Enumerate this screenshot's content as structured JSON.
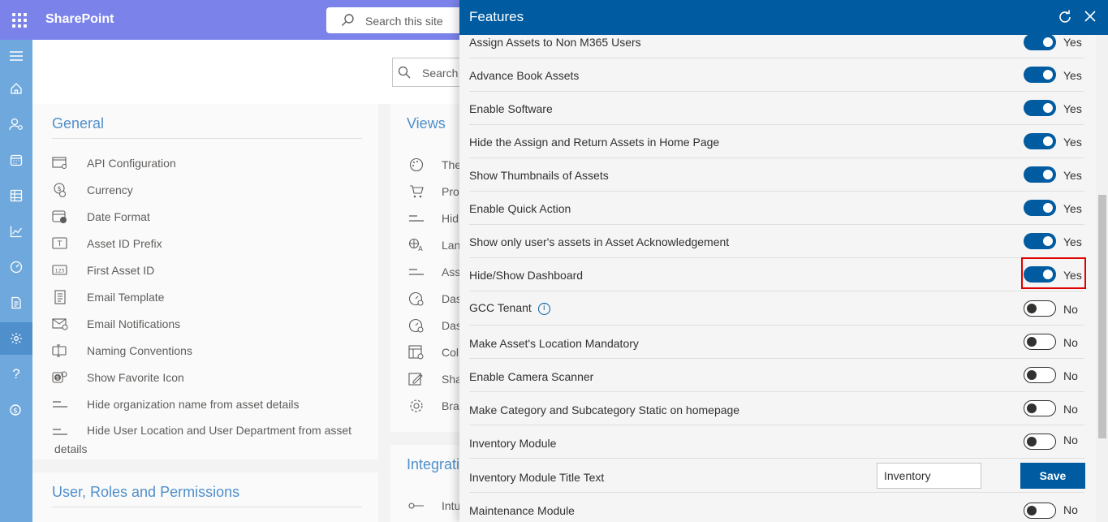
{
  "topbar": {
    "app_name": "SharePoint",
    "search_placeholder": "Search this site"
  },
  "main": {
    "search_placeholder": "Search"
  },
  "general": {
    "title": "General",
    "items": [
      {
        "label": "API Configuration",
        "icon": "api-config-icon"
      },
      {
        "label": "Currency",
        "icon": "currency-icon"
      },
      {
        "label": "Date Format",
        "icon": "calendar-clock-icon"
      },
      {
        "label": "Asset ID Prefix",
        "icon": "text-field-icon"
      },
      {
        "label": "First Asset ID",
        "icon": "number-field-icon"
      },
      {
        "label": "Email Template",
        "icon": "document-icon"
      },
      {
        "label": "Email Notifications",
        "icon": "mail-settings-icon"
      },
      {
        "label": "Naming Conventions",
        "icon": "rename-icon"
      },
      {
        "label": "Show Favorite Icon",
        "icon": "favorite-icon"
      },
      {
        "label": "Hide organization name from asset details",
        "icon": "lines-icon"
      },
      {
        "label": "Hide User Location and User Department from asset",
        "label2": "details",
        "icon": "lines-icon"
      }
    ]
  },
  "views": {
    "title": "Views",
    "items": [
      {
        "label": "The",
        "icon": "palette-icon"
      },
      {
        "label": "Pro",
        "icon": "cart-icon"
      },
      {
        "label": "Hid",
        "icon": "lines-icon"
      },
      {
        "label": "Lan",
        "icon": "language-icon"
      },
      {
        "label": "Ass",
        "icon": "lines-icon"
      },
      {
        "label": "Das",
        "icon": "gauge-icon"
      },
      {
        "label": "Das",
        "icon": "gauge-icon"
      },
      {
        "label": "Col",
        "icon": "columns-icon"
      },
      {
        "label": "Sha",
        "icon": "edit-icon"
      },
      {
        "label": "Bra",
        "icon": "gear-icon"
      }
    ]
  },
  "integrations": {
    "title": "Integrati",
    "items": [
      {
        "label": "Intu",
        "icon": "key-icon"
      }
    ]
  },
  "users_section": {
    "title": "User, Roles and Permissions"
  },
  "panel": {
    "title": "Features",
    "features": [
      {
        "label": "Assign Assets to Non M365 Users",
        "state": "on",
        "value": "Yes"
      },
      {
        "label": "Advance Book Assets",
        "state": "on",
        "value": "Yes"
      },
      {
        "label": "Enable Software",
        "state": "on",
        "value": "Yes"
      },
      {
        "label": "Hide the Assign and Return Assets in Home Page",
        "state": "on",
        "value": "Yes"
      },
      {
        "label": "Show Thumbnails of Assets",
        "state": "on",
        "value": "Yes"
      },
      {
        "label": "Enable Quick Action",
        "state": "on",
        "value": "Yes"
      },
      {
        "label": "Show only user's assets in Asset Acknowledgement",
        "state": "on",
        "value": "Yes"
      },
      {
        "label": "Hide/Show Dashboard",
        "state": "on",
        "value": "Yes"
      },
      {
        "label": "GCC Tenant",
        "state": "off",
        "value": "No"
      },
      {
        "label": "Make Asset's Location Mandatory",
        "state": "off",
        "value": "No"
      },
      {
        "label": "Enable Camera Scanner",
        "state": "off",
        "value": "No"
      },
      {
        "label": "Make Category and Subcategory Static on homepage",
        "state": "off",
        "value": "No"
      },
      {
        "label": "Inventory Module",
        "state": "off",
        "value": "No"
      }
    ],
    "inventory_title": {
      "label": "Inventory Module Title Text",
      "value": "Inventory",
      "save": "Save"
    },
    "maintenance": {
      "label": "Maintenance Module",
      "state": "off",
      "value": "No"
    }
  }
}
